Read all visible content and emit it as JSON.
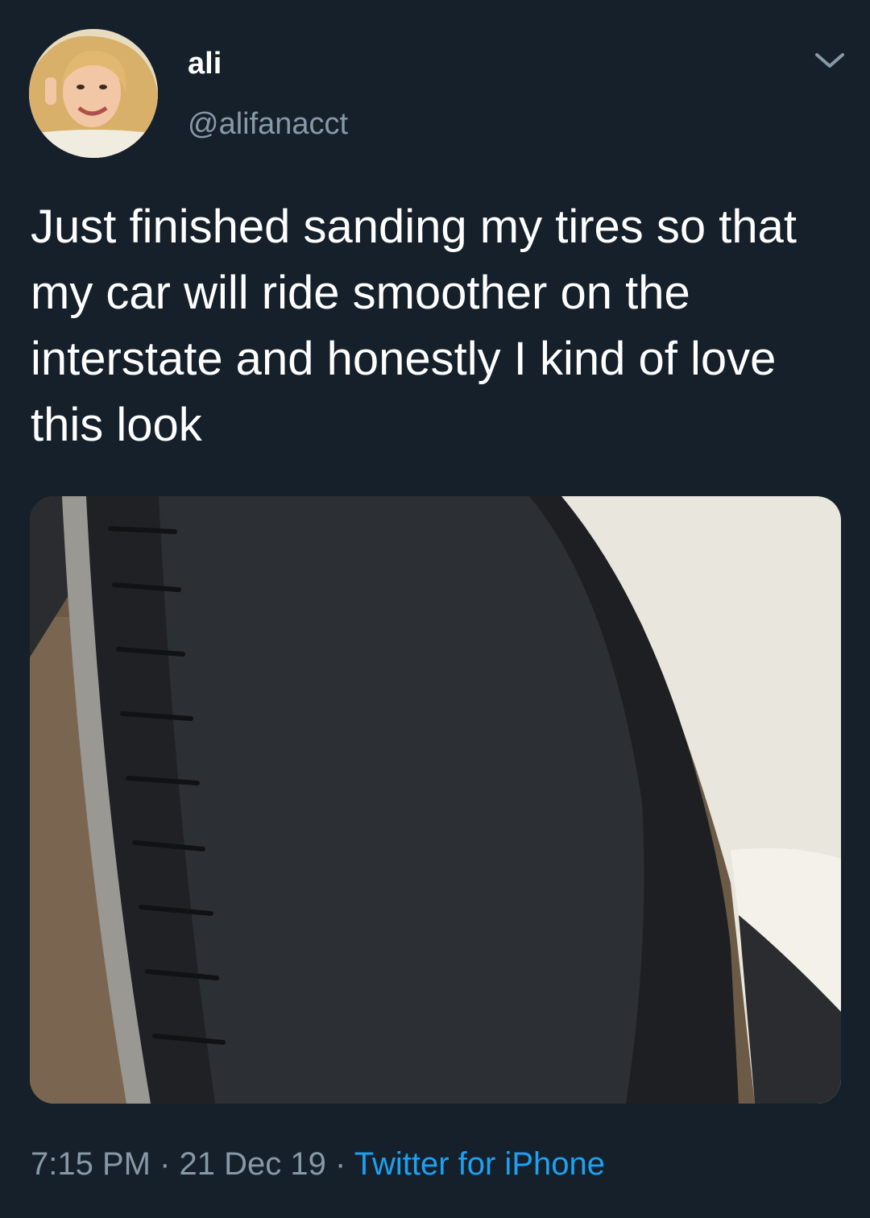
{
  "tweet": {
    "display_name": "ali",
    "handle": "@alifanacct",
    "text": "Just finished sanding my tires so that my car will ride smoother on the interstate and honestly I kind of love this look",
    "time": "7:15 PM",
    "separator": "·",
    "date": "21 Dec 19",
    "source": "Twitter for iPhone"
  },
  "icons": {
    "menu": "chevron-down-icon",
    "avatar": "avatar",
    "media": "tire-photo"
  },
  "colors": {
    "background": "#15202b",
    "secondary_text": "#8899a6",
    "link": "#1da1f2"
  }
}
